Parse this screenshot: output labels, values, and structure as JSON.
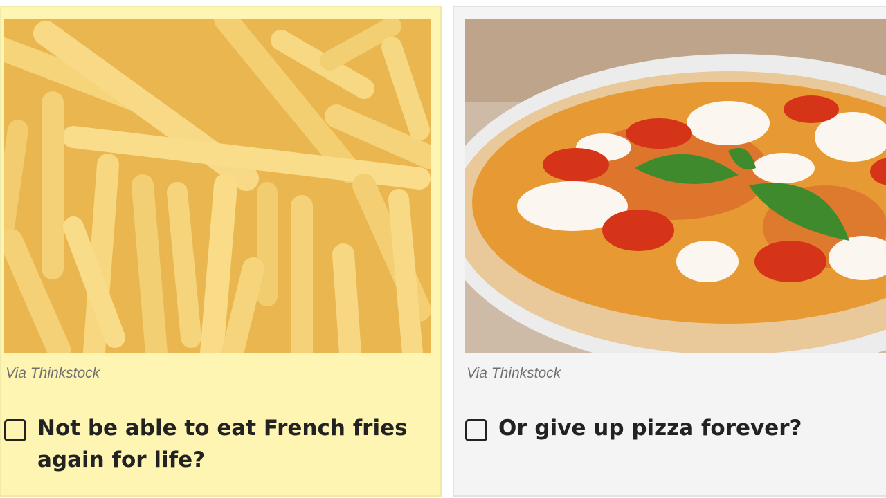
{
  "options": [
    {
      "image": "french-fries-photo",
      "credit": "Via Thinkstock",
      "label": "Not be able to eat French fries again for life?",
      "checked": false,
      "background": "#fff5b3"
    },
    {
      "image": "pizza-photo",
      "credit": "Via Thinkstock",
      "label": "Or give up pizza forever?",
      "checked": false,
      "background": "#f4f4f4"
    }
  ],
  "colors": {
    "text": "#222222",
    "credit": "#6f6f6f"
  }
}
